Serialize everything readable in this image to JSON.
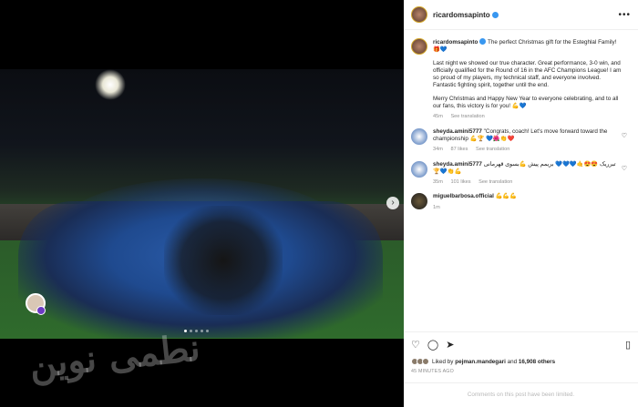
{
  "post": {
    "author": "ricardomsapinto",
    "caption_lead": "The perfect Christmas gift for the Esteghlal Family! 🎁💙",
    "caption_p1": "Last night we showed our true character. Great performance, 3-0 win, and officially qualified for the Round of 16 in the AFC Champions League! I am so proud of my players, my technical staff, and everyone involved. Fantastic fighting spirit, together until the end.",
    "caption_p2": "Merry Christmas and Happy New Year to everyone celebrating, and to all our fans, this victory is for you! 💪💙",
    "caption_time": "45m",
    "see_translation": "See translation"
  },
  "comments": [
    {
      "user": "sheyda.amini5777",
      "text": "\"Congrats, coach! Let's move forward toward the championship 💪🏆 💙🌺👏❤️",
      "time": "34m",
      "likes": "87 likes",
      "action": "See translation"
    },
    {
      "user": "sheyda.amini5777",
      "text": "تبرریک 😍😍🤙💙💙💙 بریمم پیش 💪بسوی قهرمانی 🏆💙👏💪",
      "time": "35m",
      "likes": "101 likes",
      "action": "See translation"
    },
    {
      "user": "miguelbarbosa.official",
      "text": "💪💪💪",
      "time": "1m"
    }
  ],
  "actions": {
    "liked_by_prefix": "Liked by",
    "liked_by_user": "pejman.mandegari",
    "liked_by_and": "and",
    "liked_by_others": "16,908 others",
    "time_ago": "45 MINUTES AGO",
    "limited": "Comments on this post have been limited."
  },
  "watermark": "نطمی نوین",
  "icons": {
    "more": "more-icon",
    "like": "heart-icon",
    "comment": "comment-icon",
    "share": "share-icon",
    "save": "bookmark-icon",
    "next": "chevron-right-icon"
  },
  "carousel": {
    "current": 1,
    "total": 5
  }
}
